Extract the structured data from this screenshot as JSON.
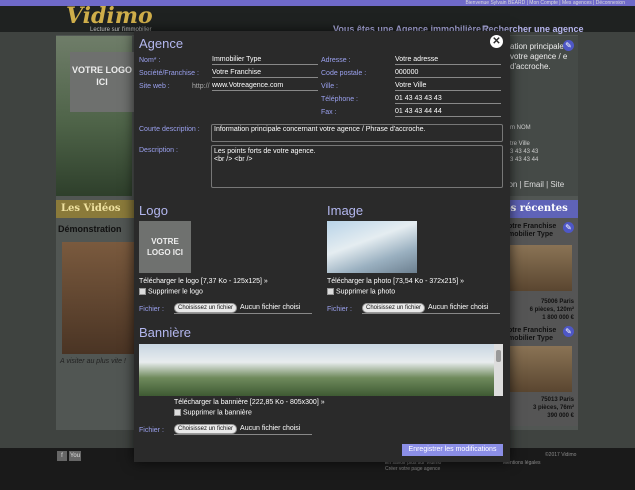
{
  "site": {
    "brand": "Vidimo",
    "tagline": "Lecture sur l'immobilier",
    "top_links": "Bienvenue Sylvain BEARD | Mon Compte | Mes agences | Déconnexion",
    "nav": [
      "Vous êtes une Agence immobilière ?",
      "Rechercher une agence"
    ],
    "logo_placeholder": "VOTRE LOGO ICI",
    "right_intro": "ation principale r votre agence / e d'accroche.",
    "right_contact": "m NOM\n\ntre Ville\n3 43 43 43\n3 43 43 44",
    "right_links": "ation | Email | Site",
    "videos_heading": "Les Vidéos",
    "videos_title": "Démonstration",
    "videos_caption": "A visiter au plus vite !",
    "recent_heading": "os récentes",
    "recent": [
      {
        "title": "otre Franchise\nmobilier Type",
        "info": "75006 Paris\n6 pièces, 120m²\n1 800 000 €"
      },
      {
        "title": "otre Franchise\nmobilier Type",
        "info": "75013 Paris\n3 pièces, 76m²\n390 000 €"
      }
    ],
    "footer_links": "En savoir plus sur Vidimo\nCréer votre page agence",
    "footer_legal": "Mentions légales",
    "footer_copy": "©2017 Vidimo",
    "social": [
      "f",
      "You"
    ]
  },
  "modal": {
    "title": "Agence",
    "close_label": "✕",
    "fields": {
      "nom": {
        "label": "Nom* :",
        "value": "Immobilier Type"
      },
      "societe": {
        "label": "Société/Franchise :",
        "value": "Votre Franchise"
      },
      "site": {
        "label": "Site web :",
        "prefix": "http://",
        "value": "www.Votreagence.com"
      },
      "adresse": {
        "label": "Adresse :",
        "value": "Votre adresse"
      },
      "cp": {
        "label": "Code postale :",
        "value": "000000"
      },
      "ville": {
        "label": "Ville :",
        "value": "Votre Ville"
      },
      "tel": {
        "label": "Téléphone :",
        "value": "01 43 43 43 43"
      },
      "fax": {
        "label": "Fax :",
        "value": "01 43 43 44 44"
      },
      "courte": {
        "label": "Courte description :",
        "value": "Information principale concernant votre agence / Phrase d'accroche."
      },
      "description": {
        "label": "Description :",
        "value": "Les points forts de votre agence.\n<br /> <br />"
      }
    },
    "logo": {
      "heading": "Logo",
      "preview": "VOTRE LOGO ICI",
      "download": "Télécharger le logo [7,37 Ko - 125x125] »",
      "delete": "Supprimer le logo"
    },
    "image": {
      "heading": "Image",
      "download": "Télécharger la photo [73,54 Ko - 372x215] »",
      "delete": "Supprimer la photo"
    },
    "banner": {
      "heading": "Bannière",
      "download": "Télécharger la bannière [222,85 Ko - 805x300] »",
      "delete": "Supprimer la bannière"
    },
    "file": {
      "label": "Fichier :",
      "button": "Choisissez un fichier",
      "none": "Aucun fichier choisi"
    },
    "save_label": "Enregistrer les modifications"
  }
}
